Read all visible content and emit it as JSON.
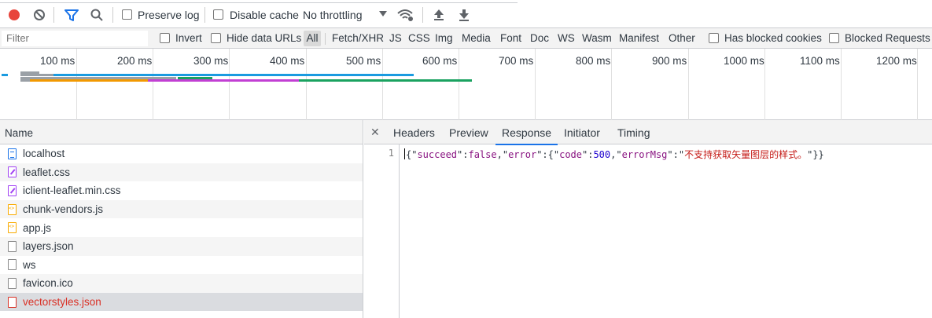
{
  "toolbar": {
    "preserve_log": "Preserve log",
    "disable_cache": "Disable cache",
    "throttling": "No throttling"
  },
  "filter_bar": {
    "placeholder": "Filter",
    "invert": "Invert",
    "hide_data_urls": "Hide data URLs",
    "types": [
      "All",
      "Fetch/XHR",
      "JS",
      "CSS",
      "Img",
      "Media",
      "Font",
      "Doc",
      "WS",
      "Wasm",
      "Manifest",
      "Other"
    ],
    "has_blocked_cookies": "Has blocked cookies",
    "blocked_requests": "Blocked Requests"
  },
  "timeline": {
    "ticks": [
      "100 ms",
      "200 ms",
      "300 ms",
      "400 ms",
      "500 ms",
      "600 ms",
      "700 ms",
      "800 ms",
      "900 ms",
      "1000 ms",
      "1100 ms",
      "1200 ms"
    ]
  },
  "request_list": {
    "header": "Name",
    "rows": [
      {
        "name": "localhost",
        "icon": "document-icon"
      },
      {
        "name": "leaflet.css",
        "icon": "stylesheet-icon"
      },
      {
        "name": "iclient-leaflet.min.css",
        "icon": "stylesheet-icon"
      },
      {
        "name": "chunk-vendors.js",
        "icon": "script-icon"
      },
      {
        "name": "app.js",
        "icon": "script-icon"
      },
      {
        "name": "layers.json",
        "icon": "file-icon"
      },
      {
        "name": "ws",
        "icon": "file-icon"
      },
      {
        "name": "favicon.ico",
        "icon": "file-icon"
      },
      {
        "name": "vectorstyles.json",
        "icon": "file-icon"
      }
    ]
  },
  "detail": {
    "tabs": [
      "Headers",
      "Preview",
      "Response",
      "Initiator",
      "Timing"
    ],
    "active_tab": "Response",
    "line_number": "1",
    "response": {
      "p1": "{\"",
      "k1": "succeed",
      "p2": "\":",
      "v1": "false",
      "p3": ",\"",
      "k2": "error",
      "p4": "\":{\"",
      "k3": "code",
      "p5": "\":",
      "v2": "500",
      "p6": ",\"",
      "k4": "errorMsg",
      "p7": "\":\"",
      "v3": "不支持获取矢量图层的样式。",
      "p8": "\"}}"
    }
  },
  "colors": {
    "record": "#e8453c",
    "filter_active": "#1a73e8",
    "selected_error": "#d93025"
  }
}
